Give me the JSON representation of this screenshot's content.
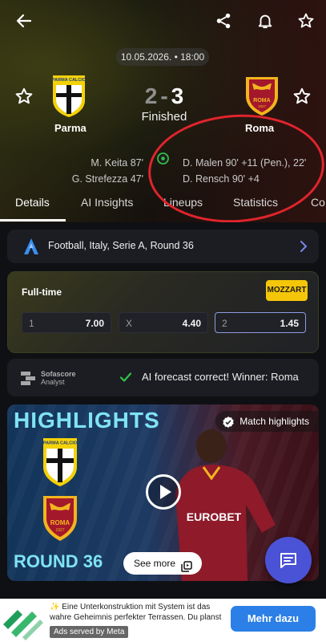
{
  "header": {
    "date": "10.05.2026. • 18:00",
    "home_team": "Parma",
    "away_team": "Roma",
    "home_score": "2",
    "away_score": "3",
    "separator": "-",
    "status": "Finished",
    "home_scorers": [
      "M. Keita 87'",
      "G. Strefezza 47'"
    ],
    "away_scorers": [
      "D. Malen 90' +11 (Pen.), 22'",
      "D. Rensch 90' +4"
    ]
  },
  "home_crest": {
    "text": "PARMA CALCIO"
  },
  "away_crest": {
    "text": "ROMA",
    "year": "1927"
  },
  "tabs": [
    "Details",
    "AI Insights",
    "Lineups",
    "Statistics",
    "Co"
  ],
  "league": {
    "label": "Football, Italy, Serie A, Round 36"
  },
  "odds": {
    "title": "Full-time",
    "bookmaker": "MOZZART",
    "options": [
      {
        "label": "1",
        "value": "7.00"
      },
      {
        "label": "X",
        "value": "4.40"
      },
      {
        "label": "2",
        "value": "1.45"
      }
    ]
  },
  "forecast": {
    "analyst_line1": "Sofascore",
    "analyst_line2": "Analyst",
    "message": "AI forecast correct! Winner: Roma"
  },
  "video": {
    "title": "HIGHLIGHTS",
    "round": "ROUND 36",
    "badge": "Match highlights",
    "see_more": "See more",
    "sponsor": "EUROBET",
    "crest_home_text": "PARMA CALCIO",
    "crest_away_text": "ROMA",
    "crest_away_year": "1927"
  },
  "ad": {
    "text": "✨ Eine Unterkonstruktion mit System ist das wahre Geheimnis perfekter Terrassen. Du planst",
    "served": "Ads served by Meta",
    "cta": "Mehr dazu"
  },
  "colors": {
    "accent": "#4a52d6",
    "highlight_text": "#7fe3f5",
    "annotation": "#e0242c",
    "bookmaker": "#f4c60a",
    "ad_button": "#2b7fe6"
  }
}
